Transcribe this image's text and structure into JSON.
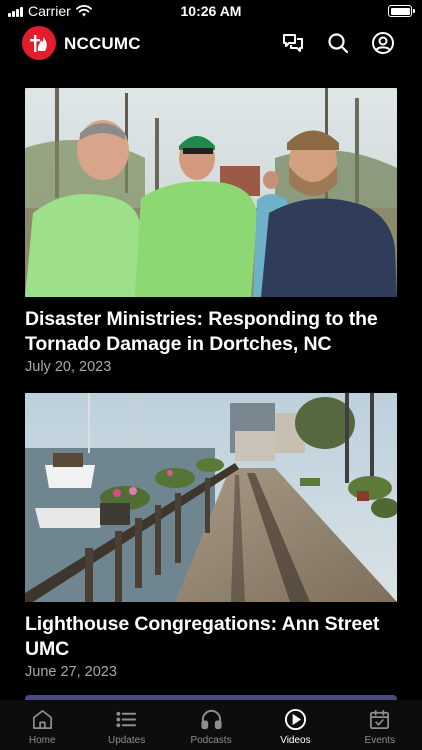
{
  "status_bar": {
    "carrier": "Carrier",
    "time": "10:26 AM"
  },
  "header": {
    "title": "NCCUMC",
    "logo_icon": "methodist-cross-flame-icon"
  },
  "colors": {
    "brand_red": "#e21d2e",
    "background": "#000000",
    "date_gray": "#a9a9a9"
  },
  "feed": {
    "items": [
      {
        "title": "Disaster Ministries: Responding to the Tornado Damage in Dortches, NC",
        "date": "July 20, 2023"
      },
      {
        "title": "Lighthouse Congregations: Ann Street UMC",
        "date": "June 27, 2023"
      }
    ]
  },
  "tabs": [
    {
      "label": "Home",
      "icon": "home-icon",
      "active": false
    },
    {
      "label": "Updates",
      "icon": "list-icon",
      "active": false
    },
    {
      "label": "Podcasts",
      "icon": "headphones-icon",
      "active": false
    },
    {
      "label": "Videos",
      "icon": "play-circle-icon",
      "active": true
    },
    {
      "label": "Events",
      "icon": "calendar-icon",
      "active": false
    }
  ]
}
